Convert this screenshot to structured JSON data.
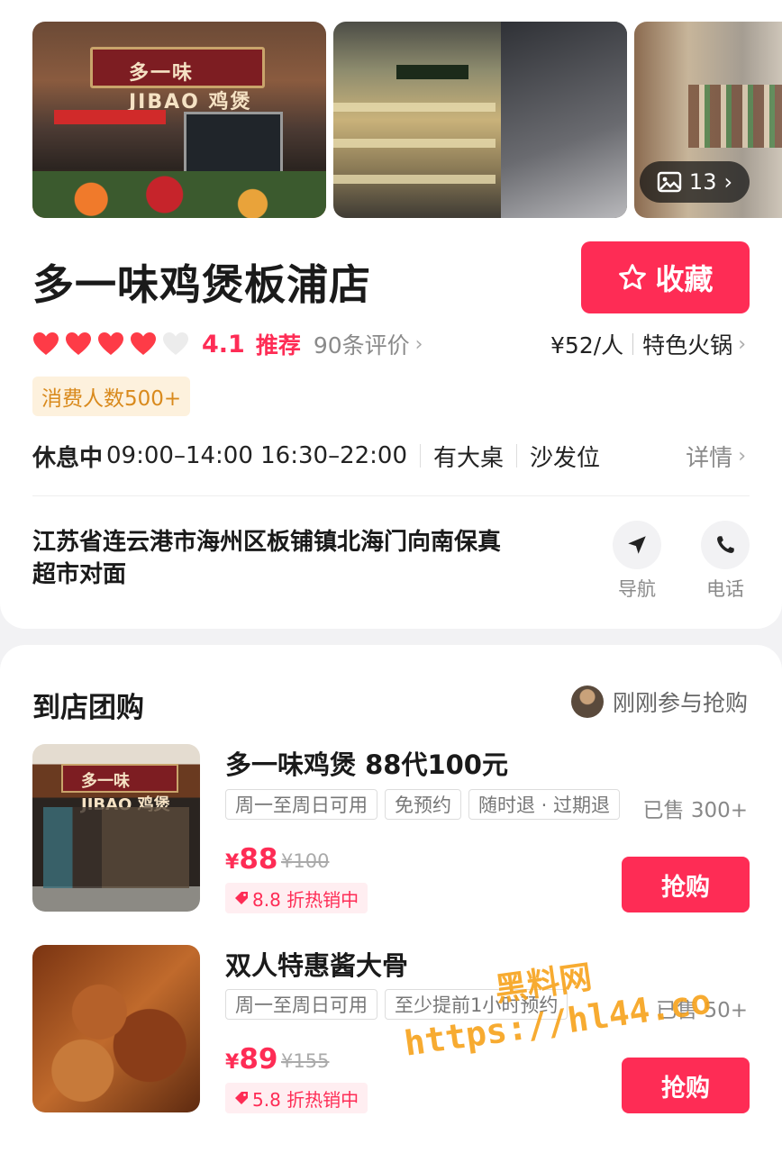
{
  "gallery": {
    "photo1_sign": "多一味 JIBAO 鸡煲",
    "photo_count": "13"
  },
  "store": {
    "name": "多一味鸡煲板浦店",
    "favorite_label": "收藏",
    "rating": "4.1",
    "hearts_filled": 4,
    "hearts_total": 5,
    "recommend_label": "推荐",
    "reviews": "90条评价",
    "price_per_person": "¥52/人",
    "category": "特色火锅",
    "consumers_badge": "消费人数500+",
    "status": "休息中",
    "hours": "09:00–14:00 16:30–22:00",
    "feature1": "有大桌",
    "feature2": "沙发位",
    "details_label": "详情",
    "address": "江苏省连云港市海州区板铺镇北海门向南保真超市对面",
    "nav_label": "导航",
    "call_label": "电话"
  },
  "group_buy": {
    "title": "到店团购",
    "recent_activity": "刚刚参与抢购",
    "deals": [
      {
        "img_sign": "多一味 JIBAO 鸡煲",
        "title": "多一味鸡煲 88代100元",
        "tags": [
          "周一至周日可用",
          "免预约",
          "随时退 · 过期退"
        ],
        "sold": "已售 300+",
        "currency": "¥",
        "price": "88",
        "original_price": "¥100",
        "discount": "8.8 折热销中",
        "buy_label": "抢购"
      },
      {
        "title": "双人特惠酱大骨",
        "tags": [
          "周一至周日可用",
          "至少提前1小时预约"
        ],
        "sold": "已售 50+",
        "currency": "¥",
        "price": "89",
        "original_price": "¥155",
        "discount": "5.8 折热销中",
        "buy_label": "抢购"
      }
    ]
  },
  "watermark": {
    "line1": "黑料网",
    "line2": "https://hl44.co"
  },
  "colors": {
    "accent": "#fe2c55",
    "badge_text": "#d98a1d",
    "badge_bg": "#fdf1dd",
    "watermark": "#f7a21b"
  }
}
